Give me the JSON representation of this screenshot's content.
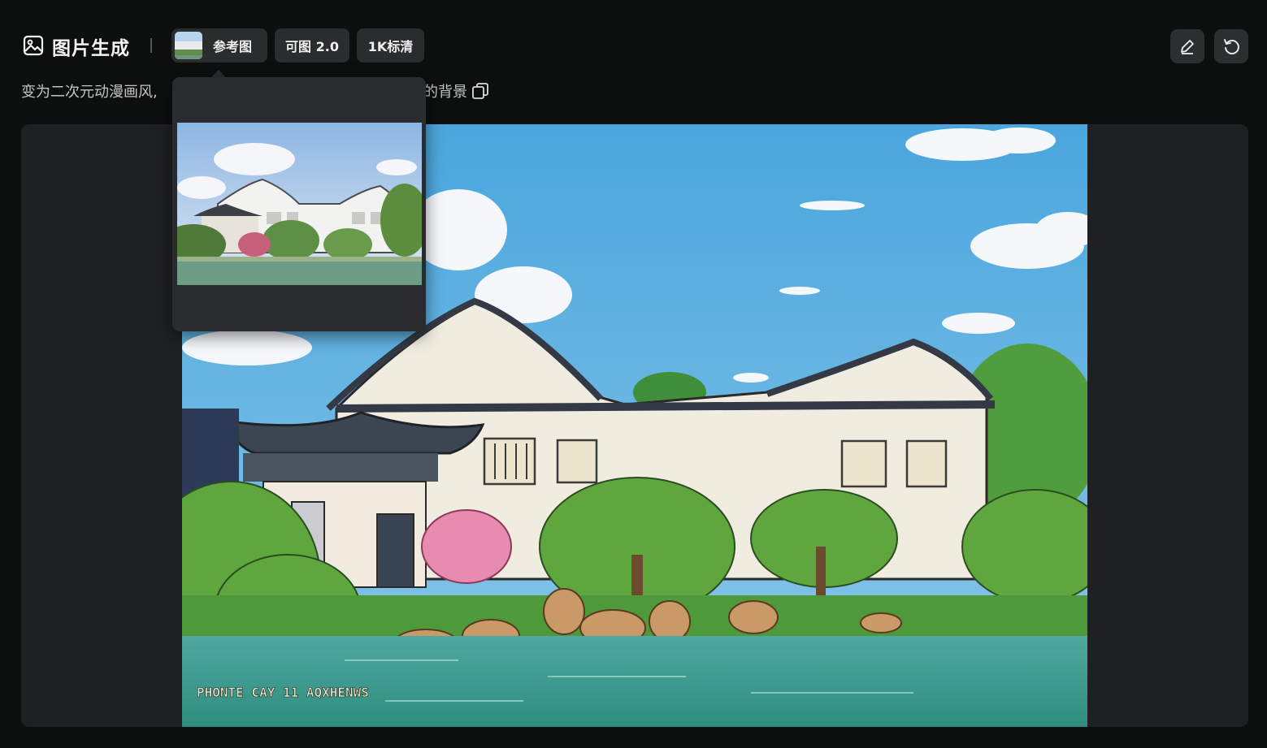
{
  "header": {
    "title": "图片生成",
    "title_icon": "image-icon",
    "reference_chip_label": "参考图",
    "model_chip_label": "可图 2.0",
    "resolution_chip_label": "1K标清",
    "edit_icon": "pencil-icon",
    "undo_icon": "undo-icon"
  },
  "prompt": {
    "text_visible_start": "变为二次元动漫画风,",
    "text_visible_end": "的背景",
    "copy_icon": "copy-icon"
  },
  "reference_popover": {
    "image_icon": "reference-image"
  },
  "result": {
    "watermark_text": "PHONTE CAY 11 AQXHENWS"
  },
  "colors": {
    "background": "#0d0f0f",
    "chip": "#2a2c2e",
    "canvas": "#1f2021",
    "popover": "#2a2b2e"
  }
}
